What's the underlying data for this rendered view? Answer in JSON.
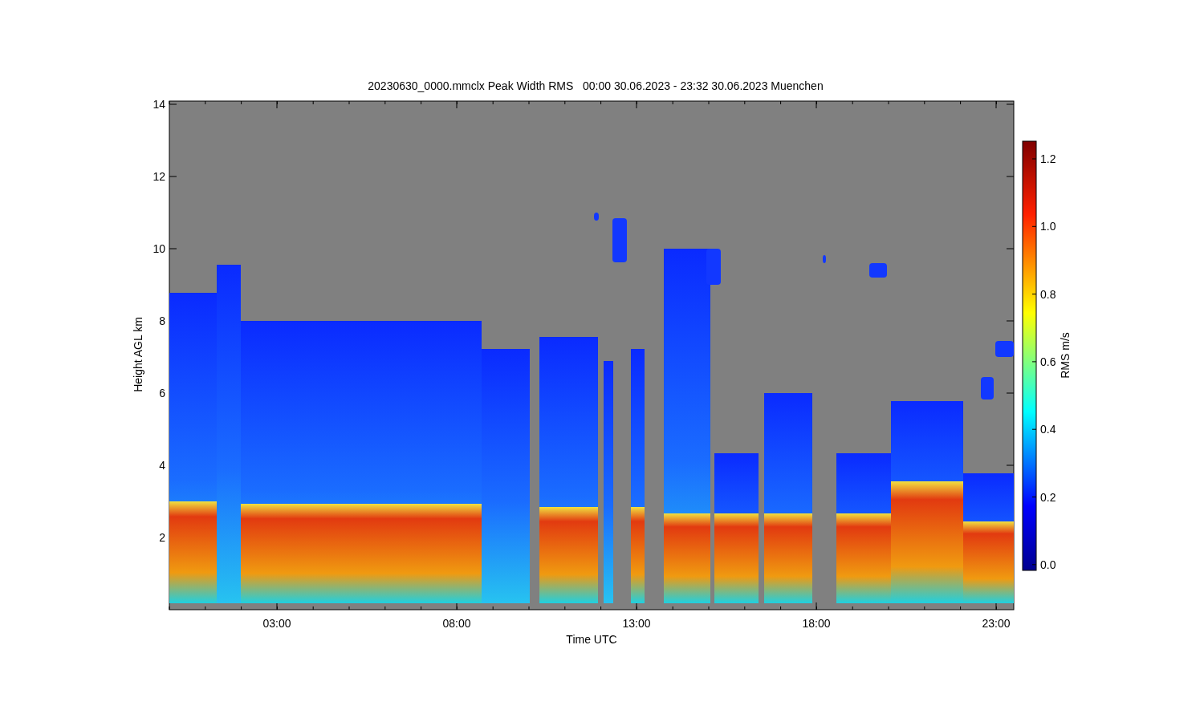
{
  "title": "20230630_0000.mmclx Peak Width RMS   00:00 30.06.2023 - 23:32 30.06.2023 Muenchen",
  "plot": {
    "xlabel": "Time UTC",
    "ylabel": "Height AGL km",
    "xticks": [
      "03:00",
      "08:00",
      "13:00",
      "18:00",
      "23:00"
    ],
    "yticks": [
      "14",
      "12",
      "10",
      "8",
      "6",
      "4",
      "2"
    ]
  },
  "colorbar": {
    "label": "RMS m/s",
    "ticks": [
      "1.2",
      "1.0",
      "0.8",
      "0.6",
      "0.4",
      "0.2",
      "0.0"
    ]
  }
}
